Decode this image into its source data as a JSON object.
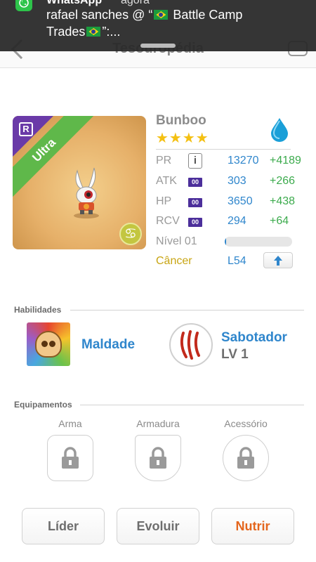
{
  "notification": {
    "app": "WhatsApp",
    "time": "agora",
    "line1_prefix": "rafael sanches @ “",
    "line1_suffix": " Battle Camp",
    "line2_prefix": "Trades",
    "line2_suffix": "”:..."
  },
  "header": {
    "title": "Tesouropédia"
  },
  "monster": {
    "name": "Bunboo",
    "stars": "★★★★",
    "rarity": "Ultra",
    "rarity_badge": "R",
    "element_icon": "water-drop-icon",
    "zodiac_symbol": "♋",
    "stats": [
      {
        "label": "PR",
        "value": "13270",
        "bonus": "+4189"
      },
      {
        "label": "ATK",
        "badge": "00",
        "value": "303",
        "bonus": "+266"
      },
      {
        "label": "HP",
        "badge": "00",
        "value": "3650",
        "bonus": "+438"
      },
      {
        "label": "RCV",
        "badge": "00",
        "value": "294",
        "bonus": "+64"
      }
    ],
    "level_label": "Nível 01",
    "level_progress": 0.02,
    "sign_label": "Câncer",
    "level_cap": "L54"
  },
  "abilities": {
    "title": "Habilidades",
    "skill1": {
      "name": "Maldade"
    },
    "skill2": {
      "name": "Sabotador",
      "level": "LV 1"
    }
  },
  "equipment": {
    "title": "Equipamentos",
    "slots": [
      {
        "label": "Arma"
      },
      {
        "label": "Armadura"
      },
      {
        "label": "Acessório"
      }
    ]
  },
  "actions": {
    "leader": "Líder",
    "evolve": "Evoluir",
    "feed": "Nutrir"
  },
  "colors": {
    "accent_blue": "#2f86cc",
    "bonus_green": "#3cab4d",
    "feed_orange": "#e4661d",
    "star_gold": "#f4c012"
  }
}
